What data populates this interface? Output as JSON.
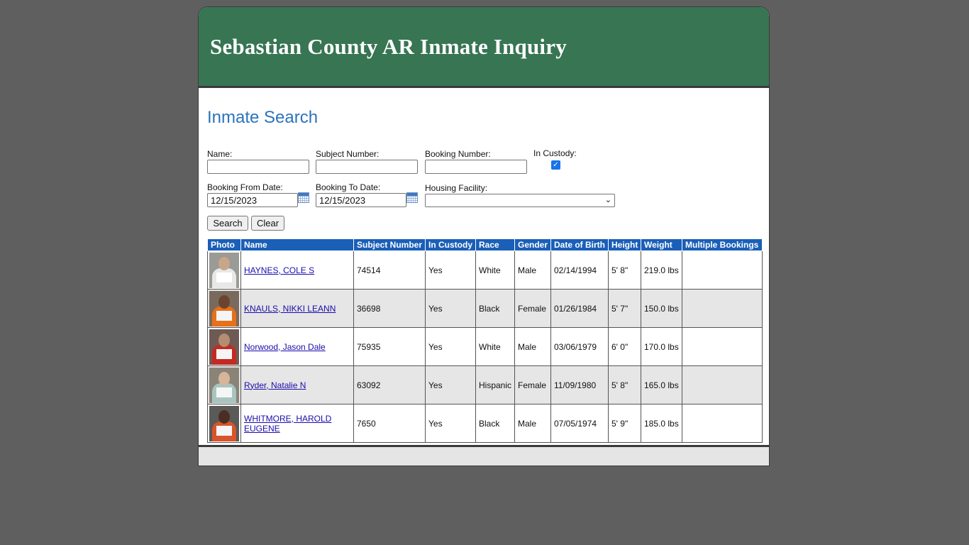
{
  "header": {
    "title": "Sebastian County AR Inmate Inquiry"
  },
  "search": {
    "heading": "Inmate Search",
    "name_label": "Name:",
    "name_value": "",
    "subject_label": "Subject Number:",
    "subject_value": "",
    "booking_label": "Booking Number:",
    "booking_value": "",
    "custody_label": "In Custody:",
    "custody_checked": true,
    "from_label": "Booking From Date:",
    "from_value": "12/15/2023",
    "to_label": "Booking To Date:",
    "to_value": "12/15/2023",
    "facility_label": "Housing Facility:",
    "facility_value": "",
    "search_button": "Search",
    "clear_button": "Clear"
  },
  "results": {
    "columns": [
      "Photo",
      "Name",
      "Subject Number",
      "In Custody",
      "Race",
      "Gender",
      "Date of Birth",
      "Height",
      "Weight",
      "Multiple Bookings"
    ],
    "rows": [
      {
        "name": "HAYNES, COLE S",
        "subject": "74514",
        "custody": "Yes",
        "race": "White",
        "gender": "Male",
        "dob": "02/14/1994",
        "height": "5' 8\"",
        "weight": "219.0 lbs",
        "multiple": ""
      },
      {
        "name": "KNAULS, NIKKI LEANN",
        "subject": "36698",
        "custody": "Yes",
        "race": "Black",
        "gender": "Female",
        "dob": "01/26/1984",
        "height": "5' 7\"",
        "weight": "150.0 lbs",
        "multiple": ""
      },
      {
        "name": "Norwood, Jason Dale",
        "subject": "75935",
        "custody": "Yes",
        "race": "White",
        "gender": "Male",
        "dob": "03/06/1979",
        "height": "6' 0\"",
        "weight": "170.0 lbs",
        "multiple": ""
      },
      {
        "name": "Ryder, Natalie N",
        "subject": "63092",
        "custody": "Yes",
        "race": "Hispanic",
        "gender": "Female",
        "dob": "11/09/1980",
        "height": "5' 8\"",
        "weight": "165.0 lbs",
        "multiple": ""
      },
      {
        "name": "WHITMORE, HAROLD EUGENE",
        "subject": "7650",
        "custody": "Yes",
        "race": "Black",
        "gender": "Male",
        "dob": "07/05/1974",
        "height": "5' 9\"",
        "weight": "185.0 lbs",
        "multiple": ""
      }
    ]
  },
  "colors": {
    "banner": "#377553",
    "heading": "#2b73bd",
    "table_header": "#1a5fb8",
    "background": "#5f5f5f"
  }
}
